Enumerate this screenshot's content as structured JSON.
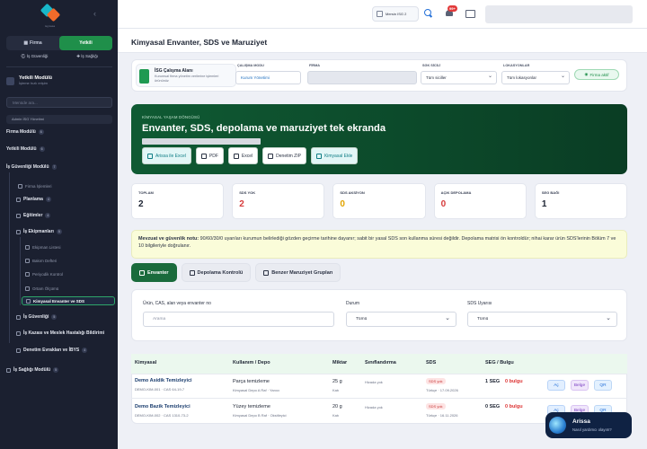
{
  "sidebar": {
    "logo_text": "isg kasa",
    "tabs": [
      {
        "label": "Firma"
      },
      {
        "label": "Yetkili"
      }
    ],
    "subtabs": [
      {
        "label": "İş Güvenliği"
      },
      {
        "label": "İş Sağlığı"
      }
    ],
    "module": {
      "title": "Yetkili Modülü",
      "subtitle": "İşleme hızlı erişim"
    },
    "search_placeholder": "Menüde ara...",
    "admin_label": "Admin İSG Yönetimi",
    "items": [
      {
        "label": "Firma Modülü",
        "badge": "6"
      },
      {
        "label": "Yetkili Modülü",
        "badge": "6"
      },
      {
        "label": "İş Güvenliği Modülü",
        "badge": "7"
      },
      {
        "label": "Firma İşlemleri"
      },
      {
        "label": "Planlama",
        "badge": "4"
      },
      {
        "label": "Eğitimler",
        "badge": "4"
      },
      {
        "label": "İş Ekipmanları",
        "badge": "5"
      },
      {
        "label": "Ekipman Listesi"
      },
      {
        "label": "Bakım Defteri"
      },
      {
        "label": "Periyodik Kontrol"
      },
      {
        "label": "Ortam Ölçümü"
      },
      {
        "label": "Kimyasal Envanter ve SDS"
      },
      {
        "label": "İş Güvenliği",
        "badge": "5"
      },
      {
        "label": "İş Kazası ve Meslek Hastalığı Bildirimi"
      },
      {
        "label": "Denetim Evrakları ve İBYS",
        "badge": "4"
      },
      {
        "label": "İş Sağlığı Modülü",
        "badge": "5"
      }
    ]
  },
  "topbar": {
    "user_label": "Mersin ISG 2",
    "notif_count": "99+"
  },
  "page": {
    "title": "Kimyasal Envanter, SDS ve Maruziyet"
  },
  "filter": {
    "area_title": "İSG Çalışma Alanı",
    "area_desc": "Kurumsal firma yönetim verilerine işlemleri ürününüz",
    "mode_label": "ÇALIŞMA MODU",
    "mode_value": "Kurum Yönetimi",
    "firma_label": "FİRMA",
    "sgk_label": "SGK SİCİLİ",
    "sgk_value": "Tüm siciller",
    "lok_label": "LOKASYONLAR",
    "lok_value": "Tüm lokasyonlar",
    "status_label": "Firma aktif"
  },
  "hero": {
    "kicker": "KİMYASAL YAŞAM DÖNGÜSÜ",
    "title": "Envanter, SDS, depolama ve maruziyet tek ekranda",
    "buttons": [
      {
        "label": "Arissa ile Excel"
      },
      {
        "label": "PDF"
      },
      {
        "label": "Excel"
      },
      {
        "label": "Denetim ZIP"
      },
      {
        "label": "Kimyasal Ekle"
      }
    ]
  },
  "stats": [
    {
      "label": "TOPLAM",
      "value": "2",
      "color": "#1d2433"
    },
    {
      "label": "SDS YOK",
      "value": "2",
      "color": "#d63a3a"
    },
    {
      "label": "SDS AKSİYON",
      "value": "0",
      "color": "#e2a400"
    },
    {
      "label": "AÇIK DEPOLAMA",
      "value": "0",
      "color": "#d63a3a"
    },
    {
      "label": "SEG BAĞI",
      "value": "1",
      "color": "#1d2433"
    }
  ],
  "note": {
    "bold": "Mevzuat ve güvenlik notu:",
    "text": " 90/60/30/0 uyarıları kurumun belirlediği gözden geçirme tarihine dayanır; sabit bir yasal SDS son kullanma süresi değildir. Depolama matrisi ön kontroldür; nihai karar ürün SDS'lerinin Bölüm 7 ve 10 bilgileriyle doğrulanır."
  },
  "tabs": [
    {
      "label": "Envanter"
    },
    {
      "label": "Depolama Kontrolü"
    },
    {
      "label": "Benzer Maruziyet Grupları"
    }
  ],
  "search": {
    "q_label": "Ürün, CAS, alan veya envanter no",
    "q_placeholder": "Arama",
    "status_label": "Durum",
    "status_value": "Tümü",
    "sds_label": "SDS Uyarısı",
    "sds_value": "Tümü"
  },
  "table": {
    "headers": [
      "Kimyasal",
      "Kullanım / Depo",
      "Miktar",
      "Sınıflandırma",
      "SDS",
      "SEG / Bulgu"
    ],
    "rows": [
      {
        "name": "Demo Asidik Temizleyici",
        "code": "DEMO-KIM-001 · CAS 64-19-7",
        "use": "Parça temizleme",
        "depo": "Kimyasal Depo A Raf · Yanıcı",
        "amount": "25 g",
        "unit": "Katı",
        "class": "Hizada yok",
        "sds": "SDS yok",
        "sds_date": "Türkçe · 17.09.2026",
        "seg": "1 SEG",
        "bulgu": "0 bulgu",
        "actions": [
          "Aç",
          "Belge",
          "QR"
        ]
      },
      {
        "name": "Demo Bazik Temizleyici",
        "code": "DEMO-KIM-002 · CAS 1310-73-2",
        "use": "Yüzey temizleme",
        "depo": "Kimyasal Depo B Raf · Oksitleyici",
        "amount": "20 g",
        "unit": "Katı",
        "class": "Hizada yok",
        "sds": "SDS yok",
        "sds_date": "Türkçe · 16.11.2026",
        "seg": "0 SEG",
        "bulgu": "0 bulgu",
        "actions": [
          "Aç",
          "Belge",
          "QR"
        ]
      }
    ]
  },
  "chat": {
    "title": "Arissa",
    "subtitle": "Nasıl yardımcı olayım?"
  }
}
